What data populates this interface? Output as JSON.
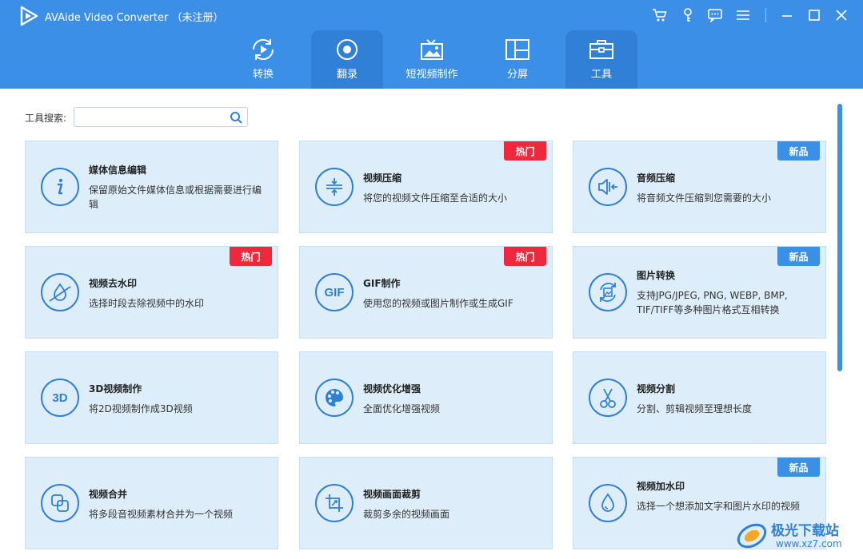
{
  "app": {
    "title": "AVAide Video Converter （未注册）",
    "accent_color": "#3b8fe6",
    "window_icons": [
      "cart-icon",
      "key-icon",
      "chat-icon",
      "menu-icon",
      "minimize-icon",
      "maximize-icon",
      "close-icon"
    ]
  },
  "nav": {
    "tabs": [
      {
        "label": "转换",
        "icon": "convert-icon"
      },
      {
        "label": "翻录",
        "icon": "rip-icon"
      },
      {
        "label": "短视频制作",
        "icon": "short-video-icon"
      },
      {
        "label": "分屏",
        "icon": "split-screen-icon"
      },
      {
        "label": "工具",
        "icon": "toolbox-icon"
      }
    ],
    "active_tab": "工具"
  },
  "search": {
    "label": "工具搜索:",
    "value": "",
    "placeholder": ""
  },
  "badges": {
    "hot": "热门",
    "new": "新品",
    "hot_color": "#f0283c",
    "new_color": "#3b8fe6"
  },
  "tools": [
    {
      "title": "媒体信息编辑",
      "desc": "保留原始文件媒体信息或根据需要进行编辑",
      "badge": "",
      "icon": "info-icon"
    },
    {
      "title": "视频压缩",
      "desc": "将您的视频文件压缩至合适的大小",
      "badge": "热门",
      "icon": "compress-icon"
    },
    {
      "title": "音频压缩",
      "desc": "将音频文件压缩到您需要的大小",
      "badge": "新品",
      "icon": "audio-compress-icon"
    },
    {
      "title": "视频去水印",
      "desc": "选择时段去除视频中的水印",
      "badge": "热门",
      "icon": "remove-watermark-icon"
    },
    {
      "title": "GIF制作",
      "desc": "使用您的视频或图片制作或生成GIF",
      "badge": "热门",
      "icon": "gif-icon"
    },
    {
      "title": "图片转换",
      "desc": "支持JPG/JPEG, PNG, WEBP, BMP, TIF/TIFF等多种图片格式互相转换",
      "badge": "新品",
      "icon": "image-convert-icon"
    },
    {
      "title": "3D视频制作",
      "desc": "将2D视频制作成3D视频",
      "badge": "",
      "icon": "3d-icon"
    },
    {
      "title": "视频优化增强",
      "desc": "全面优化增强视频",
      "badge": "",
      "icon": "palette-icon"
    },
    {
      "title": "视频分割",
      "desc": "分割、剪辑视频至理想长度",
      "badge": "",
      "icon": "scissors-icon"
    },
    {
      "title": "视频合并",
      "desc": "将多段音视频素材合并为一个视频",
      "badge": "",
      "icon": "merge-icon"
    },
    {
      "title": "视频画面裁剪",
      "desc": "裁剪多余的视频画面",
      "badge": "",
      "icon": "crop-icon"
    },
    {
      "title": "视频加水印",
      "desc": "选择一个想添加文字和图片水印的视频",
      "badge": "新品",
      "icon": "add-watermark-icon"
    }
  ],
  "watermark": {
    "text": "极光下载站",
    "url": "www.xz7.com"
  }
}
